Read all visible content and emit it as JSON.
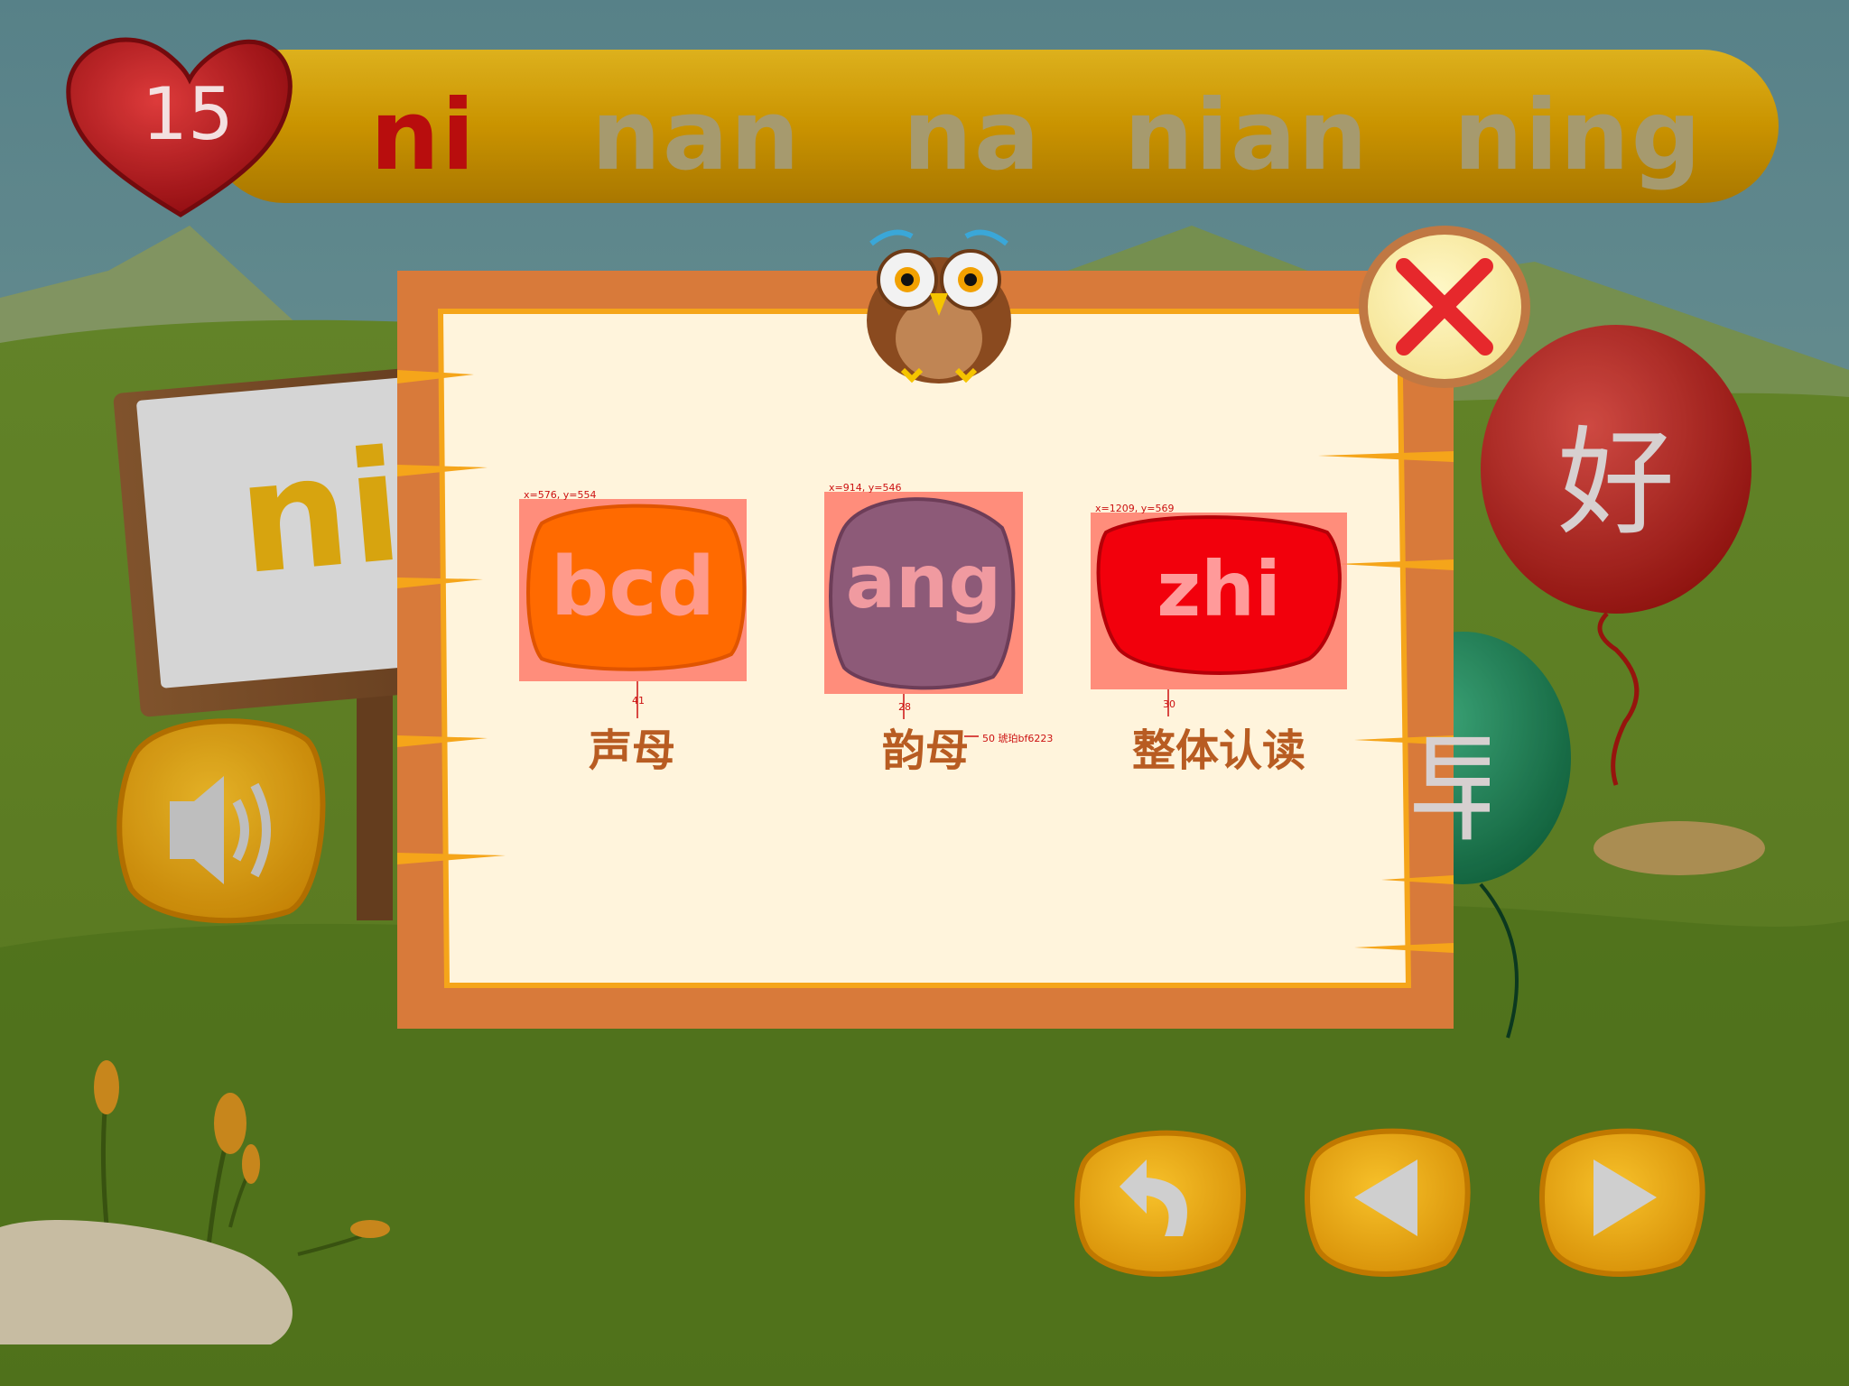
{
  "score": {
    "hearts": "15"
  },
  "syllables": [
    {
      "text": "ni",
      "state": "active"
    },
    {
      "text": "nan",
      "state": "inactive"
    },
    {
      "text": "na",
      "state": "inactive"
    },
    {
      "text": "nian",
      "state": "inactive"
    },
    {
      "text": "ning",
      "state": "inactive"
    }
  ],
  "sign": {
    "text": "ni"
  },
  "balloons": [
    {
      "char": "好",
      "color": "#c0261f"
    },
    {
      "char": "早",
      "color": "#1f8a5a"
    }
  ],
  "dialog": {
    "cards": [
      {
        "id": "initials",
        "title": "bcd",
        "label": "声母",
        "color": "#ff6a00",
        "annotation": "x=576, y=554",
        "gap": "41"
      },
      {
        "id": "finals",
        "title": "ang",
        "label": "韵母",
        "color": "#8d5a78",
        "annotation": "x=914, y=546",
        "gap": "28"
      },
      {
        "id": "whole",
        "title": "zhi",
        "label": "整体认读",
        "color": "#f2000c",
        "annotation": "x=1209, y=569",
        "gap": "30"
      }
    ],
    "label_note": "50  琥珀bf6223"
  },
  "controls": [
    "back",
    "previous",
    "next",
    "sound"
  ],
  "colors": {
    "bar": "#e0a200",
    "active_syllable": "#b80d0d",
    "inactive_syllable": "#a69a6e",
    "board": "#d87a3a",
    "paper": "#fff4dc"
  }
}
